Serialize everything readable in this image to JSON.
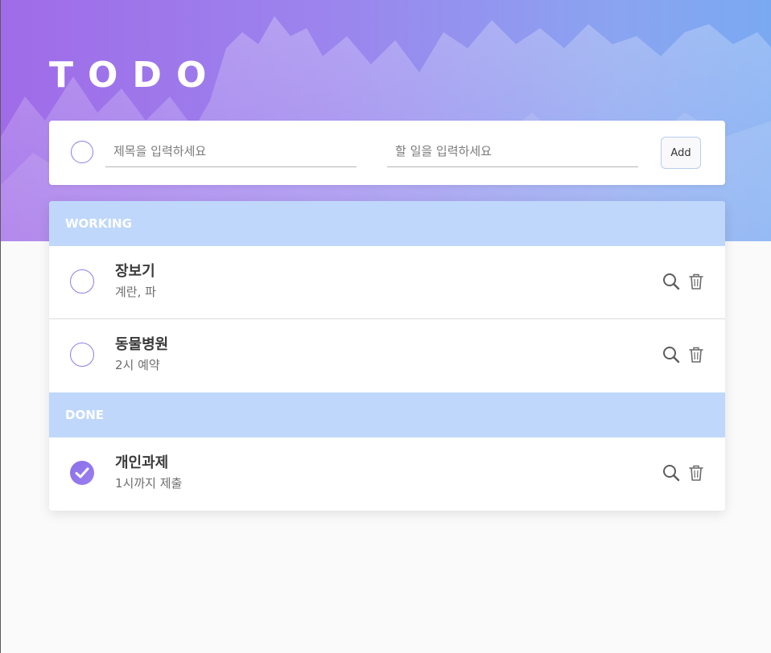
{
  "app": {
    "title": "TODO"
  },
  "form": {
    "title_placeholder": "제목을 입력하세요",
    "content_placeholder": "할 일을 입력하세요",
    "add_label": "Add"
  },
  "sections": {
    "working": {
      "label": "WORKING",
      "items": [
        {
          "title": "장보기",
          "content": "계란, 파",
          "done": false
        },
        {
          "title": "동물병원",
          "content": "2시 예약",
          "done": false
        }
      ]
    },
    "done": {
      "label": "DONE",
      "items": [
        {
          "title": "개인과제",
          "content": "1시까지 제출",
          "done": true
        }
      ]
    }
  },
  "icons": {
    "search": "search-icon",
    "trash": "trash-icon",
    "check": "check-icon"
  },
  "colors": {
    "accent": "#8b7fe6",
    "section_header": "#bfd7fb",
    "hero_start": "#a06be8",
    "hero_end": "#7aa9f2"
  }
}
